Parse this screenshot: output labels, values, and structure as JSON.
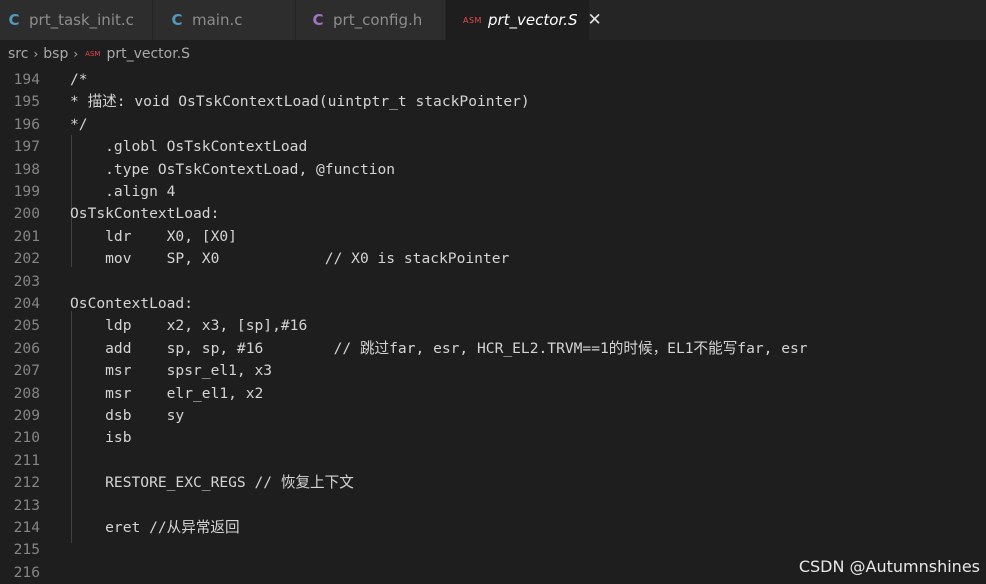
{
  "tabs": [
    {
      "icon": "C",
      "icon_color": "#519aba",
      "label": "prt_task_init.c",
      "active": false
    },
    {
      "icon": "C",
      "icon_color": "#519aba",
      "label": "main.c",
      "active": false
    },
    {
      "icon": "C",
      "icon_color": "#a074c4",
      "label": "prt_config.h",
      "active": false
    },
    {
      "icon": "ASM",
      "icon_color": "#e5484d",
      "label": "prt_vector.S",
      "active": true,
      "close": "✕"
    }
  ],
  "breadcrumb": {
    "items": [
      "src",
      "bsp",
      "prt_vector.S"
    ],
    "separator": "›",
    "file_icon": "ASM"
  },
  "editor": {
    "lines": [
      {
        "num": "194",
        "text": "/*"
      },
      {
        "num": "195",
        "text": "* 描述: void OsTskContextLoad(uintptr_t stackPointer)"
      },
      {
        "num": "196",
        "text": "*/"
      },
      {
        "num": "197",
        "text": "    .globl OsTskContextLoad"
      },
      {
        "num": "198",
        "text": "    .type OsTskContextLoad, @function"
      },
      {
        "num": "199",
        "text": "    .align 4"
      },
      {
        "num": "200",
        "text": "OsTskContextLoad:"
      },
      {
        "num": "201",
        "text": "    ldr    X0, [X0]"
      },
      {
        "num": "202",
        "text": "    mov    SP, X0            // X0 is stackPointer"
      },
      {
        "num": "203",
        "text": ""
      },
      {
        "num": "204",
        "text": "OsContextLoad:"
      },
      {
        "num": "205",
        "text": "    ldp    x2, x3, [sp],#16"
      },
      {
        "num": "206",
        "text": "    add    sp, sp, #16        // 跳过far, esr, HCR_EL2.TRVM==1的时候，EL1不能写far, esr"
      },
      {
        "num": "207",
        "text": "    msr    spsr_el1, x3"
      },
      {
        "num": "208",
        "text": "    msr    elr_el1, x2"
      },
      {
        "num": "209",
        "text": "    dsb    sy"
      },
      {
        "num": "210",
        "text": "    isb"
      },
      {
        "num": "211",
        "text": ""
      },
      {
        "num": "212",
        "text": "    RESTORE_EXC_REGS // 恢复上下文"
      },
      {
        "num": "213",
        "text": ""
      },
      {
        "num": "214",
        "text": "    eret //从异常返回"
      },
      {
        "num": "215",
        "text": ""
      },
      {
        "num": "216",
        "text": ""
      }
    ]
  },
  "watermark": "CSDN @Autumnshines",
  "colors": {
    "editor_bg": "#1e1e1e",
    "tabbar_bg": "#252526",
    "line_number": "#858585",
    "text": "#d4d4d4"
  }
}
